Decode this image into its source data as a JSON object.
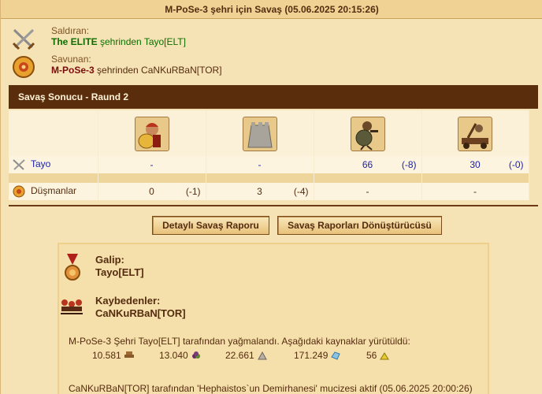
{
  "title": "M-PoSe-3 şehri için Savaş (05.06.2025 20:15:26)",
  "attacker": {
    "role": "Saldıran:",
    "city": "The ELITE",
    "from_text": " şehrinden Tayo[ELT]"
  },
  "defender": {
    "role": "Savunan:",
    "city": "M-PoSe-3",
    "from_text": " şehrinden CaNKuRBaN[TOR]"
  },
  "section_title": "Savaş Sonucu - Raund 2",
  "units": [
    "hoplite-icon",
    "wall-icon",
    "slinger-icon",
    "catapult-icon"
  ],
  "rows": {
    "attacker_label": "Tayo",
    "attacker": [
      {
        "val": "-",
        "loss": ""
      },
      {
        "val": "-",
        "loss": ""
      },
      {
        "val": "66",
        "loss": "(-8)"
      },
      {
        "val": "30",
        "loss": "(-0)"
      }
    ],
    "defender_label": "Düşmanlar",
    "defender": [
      {
        "val": "0",
        "loss": "(-1)"
      },
      {
        "val": "3",
        "loss": "(-4)"
      },
      {
        "val": "-",
        "loss": ""
      },
      {
        "val": "-",
        "loss": ""
      }
    ]
  },
  "buttons": {
    "detailed": "Detaylı Savaş Raporu",
    "converter": "Savaş Raporları Dönüştürücüsü"
  },
  "result": {
    "winner_label": "Galip:",
    "winner": "Tayo[ELT]",
    "losers_label": "Kaybedenler:",
    "loser": "CaNKuRBaN[TOR]",
    "plunder_text": "M-PoSe-3 Şehri Tayo[ELT] tarafından yağmalandı. Aşağıdaki kaynaklar yürütüldü:",
    "resources": [
      {
        "amount": "10.581",
        "icon": "wood-icon"
      },
      {
        "amount": "13.040",
        "icon": "wine-icon"
      },
      {
        "amount": "22.661",
        "icon": "marble-icon"
      },
      {
        "amount": "171.249",
        "icon": "crystal-icon"
      },
      {
        "amount": "56",
        "icon": "sulfur-icon"
      }
    ],
    "wonder_text": "CaNKuRBaN[TOR] tarafından 'Hephaistos`un Demirhanesi' mucizesi aktif (05.06.2025 20:00:26)"
  }
}
